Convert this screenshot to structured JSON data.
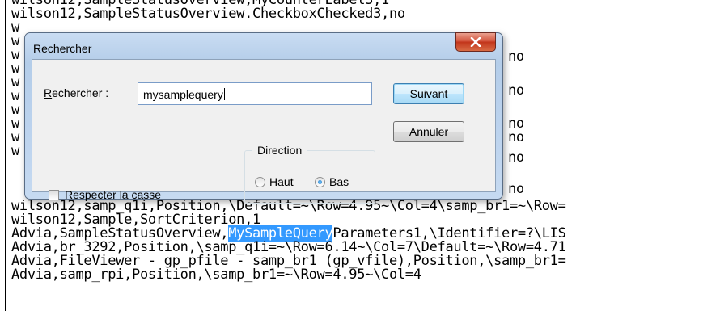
{
  "editor": {
    "lines": [
      "wilson12,SampleStatusOverview,MyCounterLabel3,1",
      "wilson12,SampleStatusOverview.CheckboxChecked3,no",
      "w",
      "w",
      "w",
      "w",
      "w",
      "w",
      "w",
      "w",
      "w",
      "w",
      "wilson12,samp_q1i,Position,\\Default=~\\Row=4.95~\\Col=4\\samp_br1=~\\Row=",
      "wilson12,Sample,SortCriterion,1",
      "Advia,SampleStatusOverview,",
      "Advia,br_3292,Position,\\samp_q1i=~\\Row=6.14~\\Col=7\\Default=~\\Row=4.71",
      "Advia,FileViewer - gp_pfile - samp_br1 (gp_vfile),Position,\\samp_br1=",
      "Advia,samp_rpi,Position,\\samp_br1=~\\Row=4.95~\\Col=4"
    ],
    "right_fragments": [
      "no",
      "no",
      "no",
      "no",
      "no",
      "no"
    ],
    "highlighted": "MySampleQuery",
    "after_highlight": "Parameters1,\\Identifier=?\\LIS"
  },
  "dialog": {
    "title": "Rechercher",
    "search_label_first": "R",
    "search_label_rest": "echercher :",
    "search_value": "mysamplequery",
    "next_label_first": "S",
    "next_label_rest": "uivant",
    "cancel_label": "Annuler",
    "direction_title": "Direction",
    "up_label_first": "H",
    "up_label_rest": "aut",
    "down_label_first": "B",
    "down_label_rest": "as",
    "direction_selected": "Bas",
    "match_case_label_pre": "Respecter la ",
    "match_case_label_u": "c",
    "match_case_label_post": "asse",
    "match_case_checked": false
  }
}
